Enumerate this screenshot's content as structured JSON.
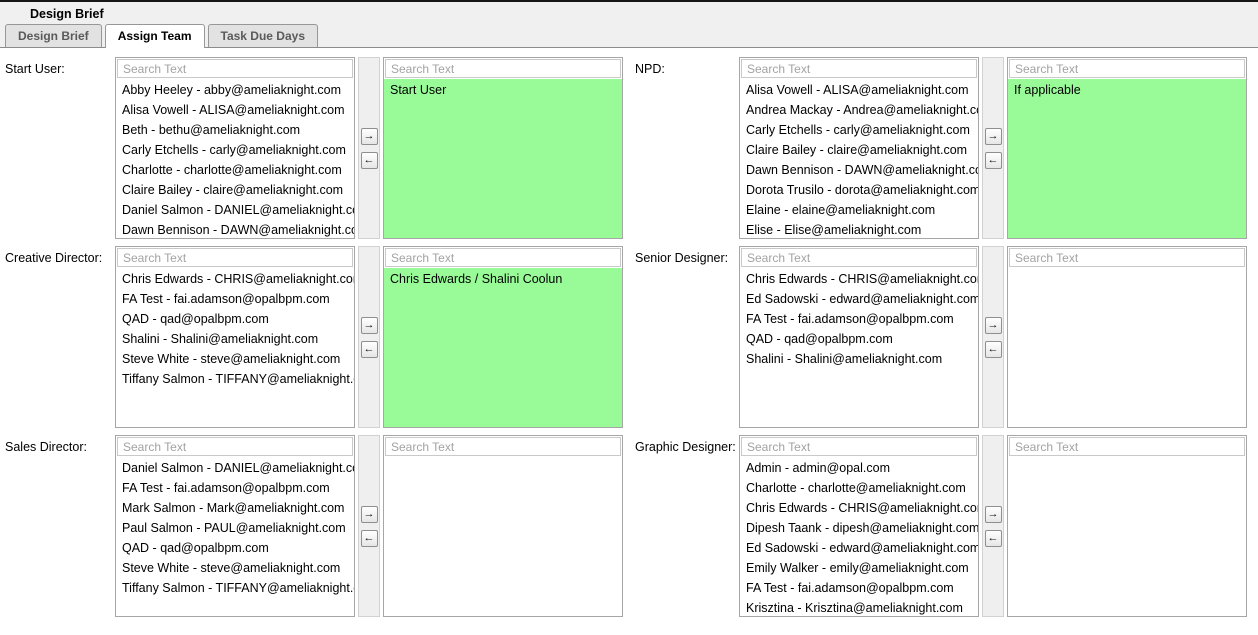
{
  "header": {
    "title": "Design Brief"
  },
  "tabs": [
    {
      "label": "Design Brief",
      "active": false
    },
    {
      "label": "Assign Team",
      "active": true
    },
    {
      "label": "Task Due Days",
      "active": false
    }
  ],
  "search_placeholder": "Search Text",
  "arrows": {
    "right": "→",
    "left": "←"
  },
  "colors": {
    "highlight": "#98fb98"
  },
  "sections": [
    {
      "label": "Start User:",
      "available": [
        "Abby Heeley - abby@ameliaknight.com",
        "Alisa Vowell - ALISA@ameliaknight.com",
        "Beth - bethu@ameliaknight.com",
        "Carly Etchells - carly@ameliaknight.com",
        "Charlotte - charlotte@ameliaknight.com",
        "Claire Bailey - claire@ameliaknight.com",
        "Daniel Salmon - DANIEL@ameliaknight.com",
        "Dawn Bennison - DAWN@ameliaknight.com"
      ],
      "selected": [
        "Start User"
      ],
      "highlighted": true
    },
    {
      "label": "NPD:",
      "available": [
        "Alisa Vowell - ALISA@ameliaknight.com",
        "Andrea Mackay - Andrea@ameliaknight.com",
        "Carly Etchells - carly@ameliaknight.com",
        "Claire Bailey - claire@ameliaknight.com",
        "Dawn Bennison - DAWN@ameliaknight.com",
        "Dorota Trusilo - dorota@ameliaknight.com",
        "Elaine - elaine@ameliaknight.com",
        "Elise - Elise@ameliaknight.com"
      ],
      "selected": [
        "If applicable"
      ],
      "highlighted": true
    },
    {
      "label": "Creative Director:",
      "available": [
        "Chris Edwards - CHRIS@ameliaknight.com",
        "FA Test - fai.adamson@opalbpm.com",
        "QAD - qad@opalbpm.com",
        "Shalini - Shalini@ameliaknight.com",
        "Steve White - steve@ameliaknight.com",
        "Tiffany Salmon - TIFFANY@ameliaknight.com"
      ],
      "selected": [
        "Chris Edwards / Shalini Coolun"
      ],
      "highlighted": true
    },
    {
      "label": "Senior Designer:",
      "available": [
        "Chris Edwards - CHRIS@ameliaknight.com",
        "Ed Sadowski - edward@ameliaknight.com",
        "FA Test - fai.adamson@opalbpm.com",
        "QAD - qad@opalbpm.com",
        "Shalini - Shalini@ameliaknight.com"
      ],
      "selected": [],
      "highlighted": false
    },
    {
      "label": "Sales Director:",
      "available": [
        "Daniel Salmon - DANIEL@ameliaknight.com",
        "FA Test - fai.adamson@opalbpm.com",
        "Mark Salmon - Mark@ameliaknight.com",
        "Paul Salmon - PAUL@ameliaknight.com",
        "QAD - qad@opalbpm.com",
        "Steve White - steve@ameliaknight.com",
        "Tiffany Salmon - TIFFANY@ameliaknight.com"
      ],
      "selected": [],
      "highlighted": false
    },
    {
      "label": "Graphic Designer:",
      "available": [
        "Admin - admin@opal.com",
        "Charlotte - charlotte@ameliaknight.com",
        "Chris Edwards - CHRIS@ameliaknight.com",
        "Dipesh Taank - dipesh@ameliaknight.com",
        "Ed Sadowski - edward@ameliaknight.com",
        "Emily Walker - emily@ameliaknight.com",
        "FA Test - fai.adamson@opalbpm.com",
        "Krisztina - Krisztina@ameliaknight.com"
      ],
      "selected": [],
      "highlighted": false
    }
  ]
}
